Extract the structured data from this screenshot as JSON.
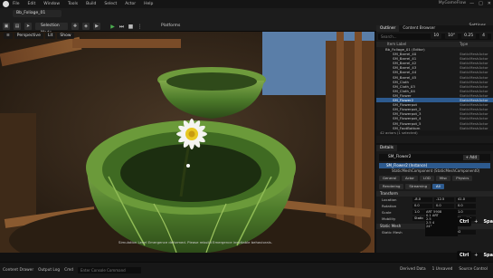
{
  "window": {
    "title": "MyGameFlow",
    "controls": [
      "—",
      "□",
      "✕"
    ]
  },
  "menu": [
    "File",
    "Edit",
    "Window",
    "Tools",
    "Build",
    "Select",
    "Actor",
    "Help"
  ],
  "level_tab": "Bb_Foliage_01",
  "toolbar": {
    "mode_label": "Selection Mode",
    "platforms_label": "Platforms",
    "settings_label": "Settings"
  },
  "viewport": {
    "perspective_label": "Perspective",
    "lit_label": "Lit",
    "show_label": "Show",
    "right_values": [
      "10",
      "10°",
      "0.25",
      "4"
    ],
    "warning": "Simulation Level Emergence deformed. Please rebuild Emergence inevitable behaviorals."
  },
  "outliner": {
    "tabs": [
      "Outliner",
      "Content Browser"
    ],
    "search_placeholder": "Search...",
    "col_label": "Item Label",
    "col_type": "Type",
    "rows": [
      {
        "label": "Bb_Foliage_01 (Editor)",
        "type": "",
        "top": true
      },
      {
        "label": "SM_Barrel_40",
        "type": "StaticMeshActor"
      },
      {
        "label": "SM_Barrel_41",
        "type": "StaticMeshActor"
      },
      {
        "label": "SM_Barrel_42",
        "type": "StaticMeshActor"
      },
      {
        "label": "SM_Barrel_43",
        "type": "StaticMeshActor"
      },
      {
        "label": "SM_Barrel_44",
        "type": "StaticMeshActor"
      },
      {
        "label": "SM_Barrel_45",
        "type": "StaticMeshActor"
      },
      {
        "label": "SM_Cloth",
        "type": "StaticMeshActor"
      },
      {
        "label": "SM_Cloth_03",
        "type": "StaticMeshActor"
      },
      {
        "label": "SM_Cloth_04",
        "type": "StaticMeshActor"
      },
      {
        "label": "SM_Flower",
        "type": "StaticMeshActor"
      },
      {
        "label": "SM_Flower2",
        "type": "StaticMeshActor",
        "selected": true
      },
      {
        "label": "SM_Flowerpot",
        "type": "StaticMeshActor"
      },
      {
        "label": "SM_Flowerpot_2",
        "type": "StaticMeshActor"
      },
      {
        "label": "SM_Flowerpot_3",
        "type": "StaticMeshActor"
      },
      {
        "label": "SM_Flowerpot_4",
        "type": "StaticMeshActor"
      },
      {
        "label": "SM_Flowerpot_5",
        "type": "StaticMeshActor"
      },
      {
        "label": "SM_FootBottom",
        "type": "StaticMeshActor"
      }
    ],
    "footer": "42 actors (1 selected)"
  },
  "details": {
    "tabs": [
      "Details"
    ],
    "actor_name": "SM_Flower2",
    "add_label": "+ Add",
    "component_selected": "SM_Flower2 (Instance)",
    "component_sub": "StaticMeshComponent (StaticMeshComponent0)",
    "filters": [
      "General",
      "Actor",
      "LOD",
      "Misc",
      "Physics",
      "Rendering",
      "Streaming",
      "All"
    ],
    "transform_label": "Transform",
    "properties": [
      {
        "name": "Location",
        "values": [
          "-8.0",
          "-12.5",
          "41.0"
        ]
      },
      {
        "name": "Rotation",
        "values": [
          "0.0",
          "0.0",
          "0.0"
        ]
      },
      {
        "name": "Scale",
        "values": [
          "1.0",
          "1.0",
          "1.0"
        ]
      },
      {
        "name": "Mobility",
        "values": [
          "Static",
          "Stationary",
          "Movable"
        ]
      }
    ],
    "static_mesh_label": "Static Mesh",
    "static_mesh_prop": "Static Mesh",
    "static_mesh_value": "SM_Flower2"
  },
  "popup": {
    "lines": [
      "ART 5908",
      "0.1 ART",
      "2.5",
      "2.5 4",
      "24°"
    ]
  },
  "keycast": {
    "top": [
      "Ctrl",
      "+",
      "Space"
    ],
    "bottom": [
      "Ctrl",
      "+",
      "Space"
    ]
  },
  "statusbar": {
    "content_drawer": "Content Drawer",
    "output_log": "Output Log",
    "cmd_label": "Cmd",
    "cmd_placeholder": "Enter Console Command",
    "derived_data": "Derived Data",
    "unsaved": "1 Unsaved",
    "source_control": "Source Control"
  }
}
